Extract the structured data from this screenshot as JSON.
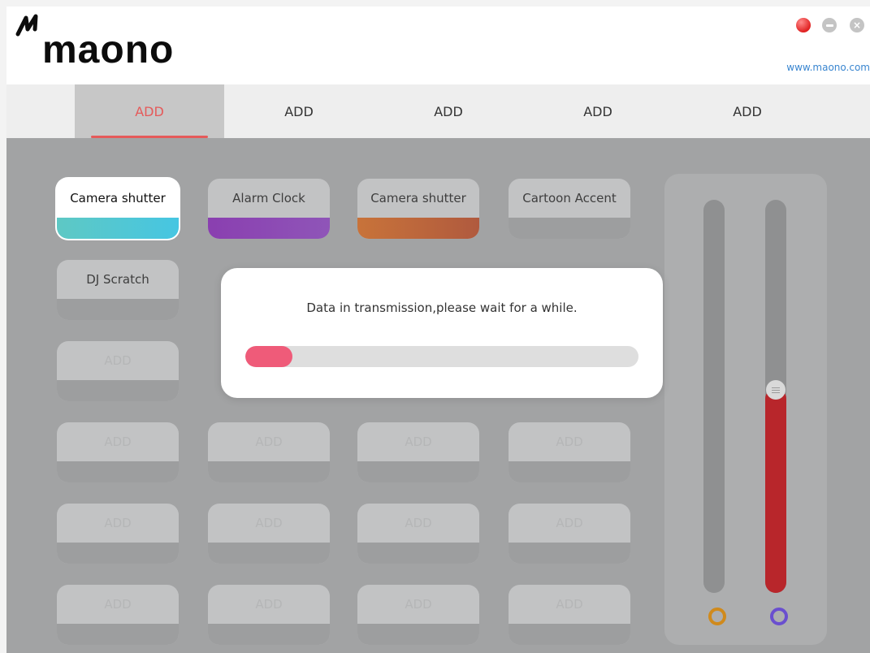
{
  "header": {
    "brand": "maono",
    "website": "www.maono.com",
    "logo_icon": "maono-m-icon",
    "window_buttons": {
      "record_color": "#e02222",
      "minimize_icon": "minimize-icon",
      "close_icon": "close-icon",
      "close_glyph": "×"
    }
  },
  "tabs": [
    {
      "label": "ADD",
      "active": true
    },
    {
      "label": "ADD",
      "active": false
    },
    {
      "label": "ADD",
      "active": false
    },
    {
      "label": "ADD",
      "active": false
    },
    {
      "label": "ADD",
      "active": false
    }
  ],
  "pads": [
    {
      "label": "Camera shutter",
      "state": "selected",
      "color": "#46c6e2"
    },
    {
      "label": "Alarm Clock",
      "state": "assigned",
      "color": "#8f55b8"
    },
    {
      "label": "Camera shutter",
      "state": "assigned",
      "color": "#c8733a"
    },
    {
      "label": "Cartoon Accent",
      "state": "assigned"
    },
    {
      "label": "DJ Scratch",
      "state": "assigned"
    },
    {
      "label": "",
      "state": "hidden"
    },
    {
      "label": "",
      "state": "hidden"
    },
    {
      "label": "",
      "state": "hidden"
    },
    {
      "label": "ADD",
      "state": "empty"
    },
    {
      "label": "",
      "state": "hidden"
    },
    {
      "label": "",
      "state": "hidden"
    },
    {
      "label": "",
      "state": "hidden"
    },
    {
      "label": "ADD",
      "state": "empty"
    },
    {
      "label": "ADD",
      "state": "empty"
    },
    {
      "label": "ADD",
      "state": "empty"
    },
    {
      "label": "ADD",
      "state": "empty"
    },
    {
      "label": "ADD",
      "state": "empty"
    },
    {
      "label": "ADD",
      "state": "empty"
    },
    {
      "label": "ADD",
      "state": "empty"
    },
    {
      "label": "ADD",
      "state": "empty"
    },
    {
      "label": "ADD",
      "state": "empty"
    },
    {
      "label": "ADD",
      "state": "empty"
    },
    {
      "label": "ADD",
      "state": "empty"
    },
    {
      "label": "ADD",
      "state": "empty"
    }
  ],
  "sliders": [
    {
      "level": 0.0,
      "ring_color": "#d08a1c"
    },
    {
      "level": 0.52,
      "ring_color": "#6a4fcf",
      "fill_color": "#b8262b"
    }
  ],
  "dialog": {
    "message": "Data in transmission,please wait for a while.",
    "progress": 0.12,
    "progress_color": "#ef5b79"
  }
}
